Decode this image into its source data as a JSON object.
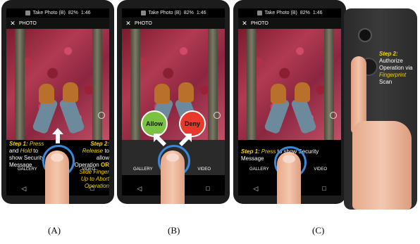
{
  "status_bar": {
    "title": "Take Photo (B)",
    "battery": "82%",
    "time": "1:46"
  },
  "app_bar": {
    "close_glyph": "✕",
    "title": "PHOTO"
  },
  "bottom": {
    "gallery": "GALLERY",
    "video": "VIDEO"
  },
  "nav": {
    "back": "◁",
    "home": "○",
    "recent": "□"
  },
  "buttons": {
    "allow": "Allow",
    "deny": "Deny"
  },
  "panel_a": {
    "step1_label": "Step 1:",
    "step1_text1": "Press",
    "step1_text2": "and",
    "step1_text3": "Hold",
    "step1_text4": "to show Security Message",
    "step2_label": "Step 2:",
    "step2_text1": "Release",
    "step2_text2": "to allow Operation",
    "step2_or": "OR",
    "step2_text3": "Slide Finger Up",
    "step2_text4": "to Abort Operation"
  },
  "panel_c": {
    "step1_label": "Step 1:",
    "step1_text1": "Press",
    "step1_text2": "to show Security Message",
    "step2_label": "Step 2:",
    "step2_text1": "Authorize Operation via",
    "step2_text2": "Fingerprint",
    "step2_text3": "Scan"
  },
  "labels": {
    "a": "(A)",
    "b": "(B)",
    "c": "(C)"
  },
  "colors": {
    "allow": "#7cc242",
    "deny": "#e8392c",
    "ring": "#3b87d8",
    "accent_text": "#f5d000"
  }
}
